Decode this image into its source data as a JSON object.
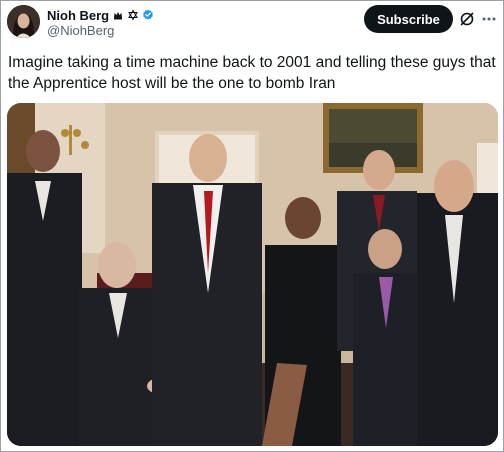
{
  "author": {
    "display_name": "Nioh Berg",
    "handle": "@NiohBerg",
    "badge_icons": [
      "crown-icon",
      "star-of-david-icon",
      "verified-badge-icon"
    ]
  },
  "actions": {
    "subscribe_label": "Subscribe",
    "grok_icon": "grok-icon",
    "more_icon": "more-icon"
  },
  "tweet": {
    "text": "Imagine taking a time machine back to 2001 and telling these guys that the Apprentice host will be the one to bomb Iran"
  },
  "media": {
    "type": "photo"
  },
  "colors": {
    "verified_blue": "#1d9bf0",
    "subscribe_bg": "#0f1419",
    "handle_gray": "#536471"
  }
}
